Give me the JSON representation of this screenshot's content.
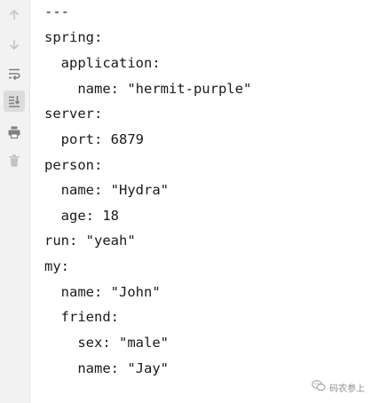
{
  "toolbar": {
    "icons": [
      "arrow-up-icon",
      "arrow-down-icon",
      "soft-wrap-icon",
      "scroll-to-end-icon",
      "print-icon",
      "trash-icon"
    ]
  },
  "lines": [
    "---",
    "spring:",
    "  application:",
    "    name: \"hermit-purple\"",
    "server:",
    "  port: 6879",
    "person:",
    "  name: \"Hydra\"",
    "  age: 18",
    "run: \"yeah\"",
    "my:",
    "  name: \"John\"",
    "  friend:",
    "    sex: \"male\"",
    "    name: \"Jay\""
  ],
  "watermark": {
    "text": "码农参上",
    "icon": "wechat-icon"
  },
  "colors": {
    "gutter": "#f2f2f2",
    "icon": "#7f7f7f",
    "icon_disabled": "#c4c4c4",
    "text": "#1a1a1a"
  }
}
